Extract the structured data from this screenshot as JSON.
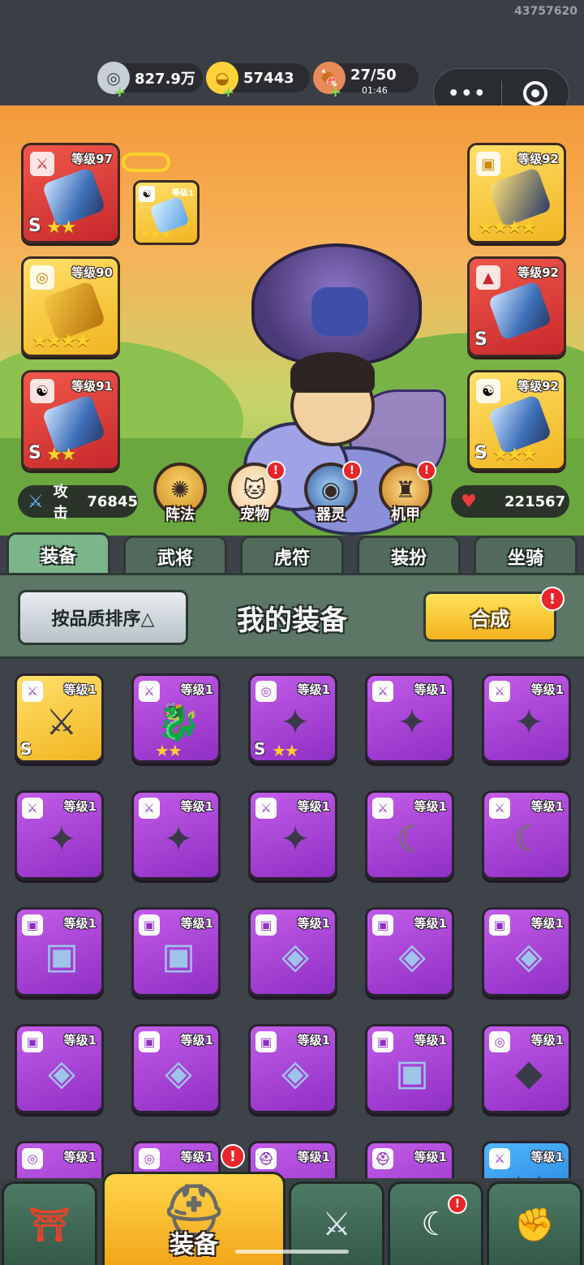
{
  "uid": "43757620",
  "resources": {
    "silver": {
      "value": "827.9万",
      "icon": "coin-icon"
    },
    "gold": {
      "value": "57443",
      "icon": "gold-ingot-icon"
    },
    "stamina": {
      "value": "27/50",
      "timer": "01:46",
      "icon": "meat-icon"
    }
  },
  "equipped": {
    "left": [
      {
        "level": "等级97",
        "grade": "S",
        "stars": "★★",
        "color": "red",
        "type": "sword"
      },
      {
        "level": "等级90",
        "grade": "",
        "stars": "★★★★",
        "color": "gold",
        "type": "medal"
      },
      {
        "level": "等级91",
        "grade": "S",
        "stars": "★★",
        "color": "red",
        "type": "yinyang"
      }
    ],
    "mini": {
      "level": "等级1",
      "stars": "★★★"
    },
    "right": [
      {
        "level": "等级92",
        "grade": "",
        "stars": "★★★★",
        "color": "gold",
        "type": "armor"
      },
      {
        "level": "等级92",
        "grade": "S",
        "stars": "",
        "color": "red",
        "type": "boot"
      },
      {
        "level": "等级92",
        "grade": "S",
        "stars": "★★★",
        "color": "gold",
        "type": "yinyang"
      }
    ]
  },
  "stats": {
    "attack_label": "攻击",
    "attack_value": "76845",
    "hp_value": "221567"
  },
  "functions": [
    {
      "label": "阵法",
      "badge": false
    },
    {
      "label": "宠物",
      "badge": true
    },
    {
      "label": "器灵",
      "badge": true
    },
    {
      "label": "机甲",
      "badge": true
    }
  ],
  "tabs": [
    {
      "label": "装备",
      "active": true,
      "badge": false
    },
    {
      "label": "武将",
      "active": false,
      "badge": true
    },
    {
      "label": "虎符",
      "active": false,
      "badge": false
    },
    {
      "label": "装扮",
      "active": false,
      "badge": false
    },
    {
      "label": "坐骑",
      "active": false,
      "badge": true
    }
  ],
  "panel": {
    "sort_label": "按品质排序△",
    "title": "我的装备",
    "synth_label": "合成"
  },
  "items": [
    {
      "level": "等级1",
      "color": "gold",
      "type": "sword",
      "art": "⚔",
      "grade": "S",
      "stars": ""
    },
    {
      "level": "等级1",
      "color": "purple",
      "type": "sword",
      "art": "🐉",
      "grade": "",
      "stars": "★★"
    },
    {
      "level": "等级1",
      "color": "purple",
      "type": "medal",
      "art": "✦",
      "grade": "S",
      "stars": "★★"
    },
    {
      "level": "等级1",
      "color": "purple",
      "type": "sword",
      "art": "✦",
      "grade": "",
      "stars": ""
    },
    {
      "level": "等级1",
      "color": "purple",
      "type": "sword",
      "art": "✦",
      "grade": "",
      "stars": ""
    },
    {
      "level": "等级1",
      "color": "purple",
      "type": "sword",
      "art": "✦",
      "grade": "",
      "stars": ""
    },
    {
      "level": "等级1",
      "color": "purple",
      "type": "sword",
      "art": "✦",
      "grade": "",
      "stars": ""
    },
    {
      "level": "等级1",
      "color": "purple",
      "type": "sword",
      "art": "✦",
      "grade": "",
      "stars": ""
    },
    {
      "level": "等级1",
      "color": "purple",
      "type": "sword",
      "art": "☾",
      "grade": "",
      "stars": ""
    },
    {
      "level": "等级1",
      "color": "purple",
      "type": "sword",
      "art": "☾",
      "grade": "",
      "stars": ""
    },
    {
      "level": "等级1",
      "color": "purple",
      "type": "armor",
      "art": "▣",
      "grade": "",
      "stars": ""
    },
    {
      "level": "等级1",
      "color": "purple",
      "type": "armor",
      "art": "▣",
      "grade": "",
      "stars": ""
    },
    {
      "level": "等级1",
      "color": "purple",
      "type": "armor",
      "art": "◈",
      "grade": "",
      "stars": ""
    },
    {
      "level": "等级1",
      "color": "purple",
      "type": "armor",
      "art": "◈",
      "grade": "",
      "stars": ""
    },
    {
      "level": "等级1",
      "color": "purple",
      "type": "armor",
      "art": "◈",
      "grade": "",
      "stars": ""
    },
    {
      "level": "等级1",
      "color": "purple",
      "type": "armor",
      "art": "◈",
      "grade": "",
      "stars": ""
    },
    {
      "level": "等级1",
      "color": "purple",
      "type": "armor",
      "art": "◈",
      "grade": "",
      "stars": ""
    },
    {
      "level": "等级1",
      "color": "purple",
      "type": "armor",
      "art": "◈",
      "grade": "",
      "stars": ""
    },
    {
      "level": "等级1",
      "color": "purple",
      "type": "armor",
      "art": "▣",
      "grade": "",
      "stars": ""
    },
    {
      "level": "等级1",
      "color": "purple",
      "type": "medal",
      "art": "◆",
      "grade": "",
      "stars": ""
    },
    {
      "level": "等级1",
      "color": "purple",
      "type": "medal",
      "art": "◆",
      "grade": "",
      "stars": ""
    },
    {
      "level": "等级1",
      "color": "purple",
      "type": "medal",
      "art": "◆",
      "grade": "",
      "stars": ""
    },
    {
      "level": "等级1",
      "color": "purple",
      "type": "helmet",
      "art": "◈",
      "grade": "",
      "stars": ""
    },
    {
      "level": "等级1",
      "color": "purple",
      "type": "helmet",
      "art": "▣",
      "grade": "",
      "stars": ""
    },
    {
      "level": "等级1",
      "color": "blue",
      "type": "sword",
      "art": "⚔",
      "grade": "",
      "stars": ""
    }
  ],
  "bottom_nav": [
    {
      "name": "shop",
      "icon": "⛩",
      "label": ""
    },
    {
      "name": "equipment",
      "icon": "⛑",
      "label": "装备",
      "active": true,
      "badge": true
    },
    {
      "name": "battle",
      "icon": "⚔",
      "label": ""
    },
    {
      "name": "hero",
      "icon": "☾",
      "label": "",
      "badge": true
    },
    {
      "name": "upgrade",
      "icon": "✊",
      "label": ""
    }
  ],
  "colors": {
    "purple": "#a845d8",
    "gold": "#f5c22a",
    "red": "#d93a36",
    "blue": "#2c8fe8",
    "badge": "#e8252b"
  }
}
